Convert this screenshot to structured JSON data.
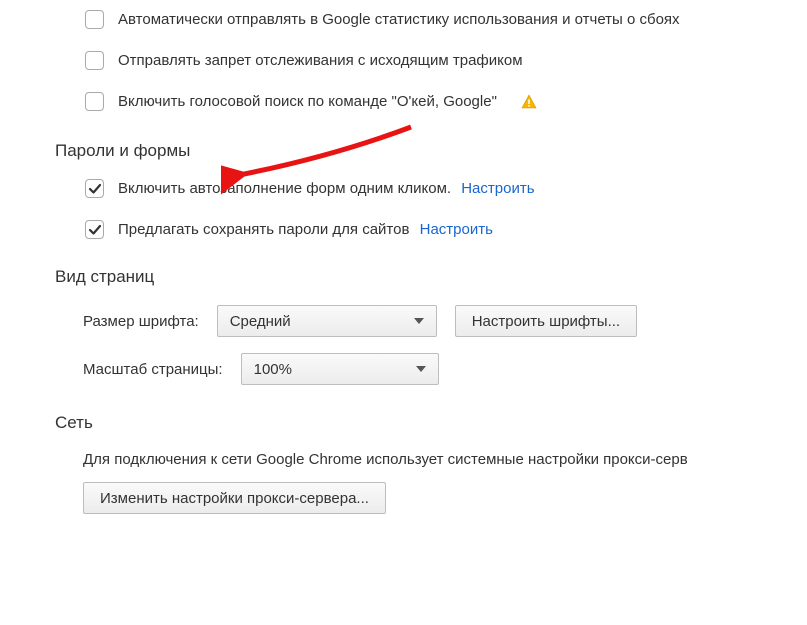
{
  "privacy": {
    "stats_label": "Автоматически отправлять в Google статистику использования и отчеты о сбоях",
    "dnt_label": "Отправлять запрет отслеживания с исходящим трафиком",
    "voice_label": "Включить голосовой поиск по команде \"О'кей, Google\""
  },
  "passwords": {
    "heading": "Пароли и формы",
    "autofill_label": "Включить автозаполнение форм одним кликом.",
    "autofill_link": "Настроить",
    "save_pw_label": "Предлагать сохранять пароли для сайтов",
    "save_pw_link": "Настроить"
  },
  "appearance": {
    "heading": "Вид страниц",
    "font_size_label": "Размер шрифта:",
    "font_size_value": "Средний",
    "font_config_button": "Настроить шрифты...",
    "zoom_label": "Масштаб страницы:",
    "zoom_value": "100%"
  },
  "network": {
    "heading": "Сеть",
    "description": "Для подключения к сети Google Chrome использует системные настройки прокси-серв",
    "proxy_button": "Изменить настройки прокси-сервера..."
  }
}
